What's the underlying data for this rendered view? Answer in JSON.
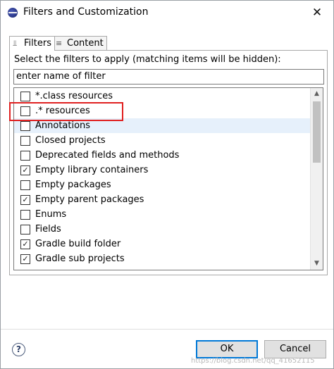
{
  "window": {
    "title": "Filters and Customization",
    "close_glyph": "✕"
  },
  "tabs": [
    {
      "label": "Filters",
      "icon": "filter-icon",
      "active": true
    },
    {
      "label": "Content",
      "icon": "content-icon",
      "active": false
    }
  ],
  "filters": {
    "instruction": "Select the filters to apply (matching items will be hidden):",
    "search_value": "enter name of filter",
    "items": [
      {
        "label": "*.class resources",
        "checked": false,
        "highlighted": false
      },
      {
        "label": ".* resources",
        "checked": false,
        "highlighted": false
      },
      {
        "label": "Annotations",
        "checked": false,
        "highlighted": true
      },
      {
        "label": "Closed projects",
        "checked": false,
        "highlighted": false
      },
      {
        "label": "Deprecated fields and methods",
        "checked": false,
        "highlighted": false
      },
      {
        "label": "Empty library containers",
        "checked": true,
        "highlighted": false
      },
      {
        "label": "Empty packages",
        "checked": false,
        "highlighted": false
      },
      {
        "label": "Empty parent packages",
        "checked": true,
        "highlighted": false
      },
      {
        "label": "Enums",
        "checked": false,
        "highlighted": false
      },
      {
        "label": "Fields",
        "checked": false,
        "highlighted": false
      },
      {
        "label": "Gradle build folder",
        "checked": true,
        "highlighted": false
      },
      {
        "label": "Gradle sub projects",
        "checked": true,
        "highlighted": false
      }
    ]
  },
  "buttons": {
    "help_glyph": "?",
    "ok_label": "OK",
    "cancel_label": "Cancel"
  },
  "watermark": "https://blog.csdn.net/qq_41652115",
  "colors": {
    "highlight_box": "#e02020",
    "row_highlight": "#e6f0fb",
    "default_button_border": "#0078d7"
  }
}
